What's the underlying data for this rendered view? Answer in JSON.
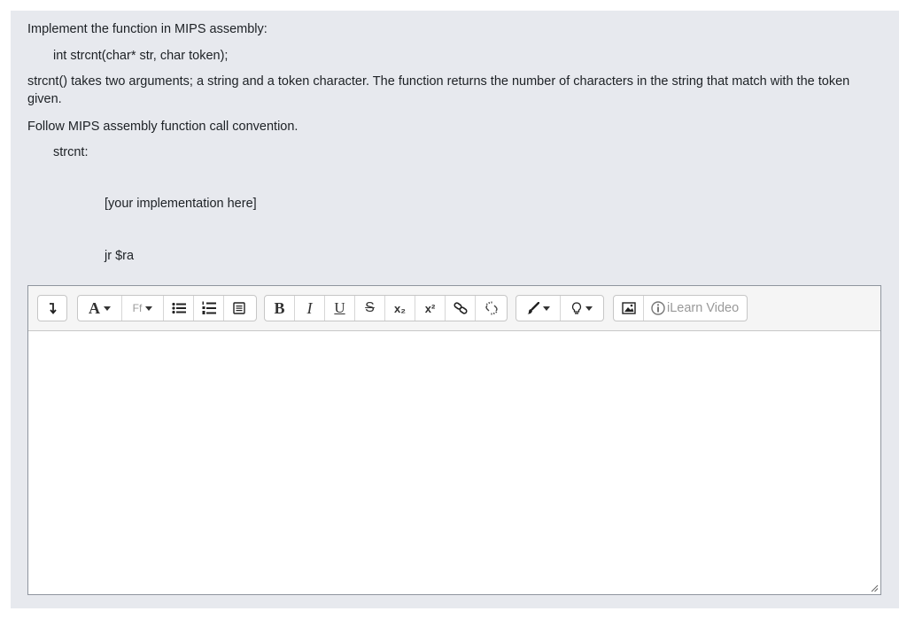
{
  "question": {
    "line1": "Implement the function in MIPS assembly:",
    "signature": "int strcnt(char* str, char token);",
    "description": "strcnt() takes two arguments; a string and a token character. The function returns the number of characters in the string that match with the token given.",
    "convention": "Follow MIPS assembly function call convention.",
    "label": "strcnt:",
    "placeholder_line": "[your implementation here]",
    "return_line": "jr $ra"
  },
  "toolbar": {
    "font_color_label": "A",
    "font_family_label": "Ff",
    "bold_label": "B",
    "italic_label": "I",
    "underline_label": "U",
    "strike_label": "S",
    "subscript_label": "x₂",
    "superscript_label": "x²",
    "ilearn_video_label": "iLearn Video"
  },
  "editor": {
    "content": ""
  }
}
